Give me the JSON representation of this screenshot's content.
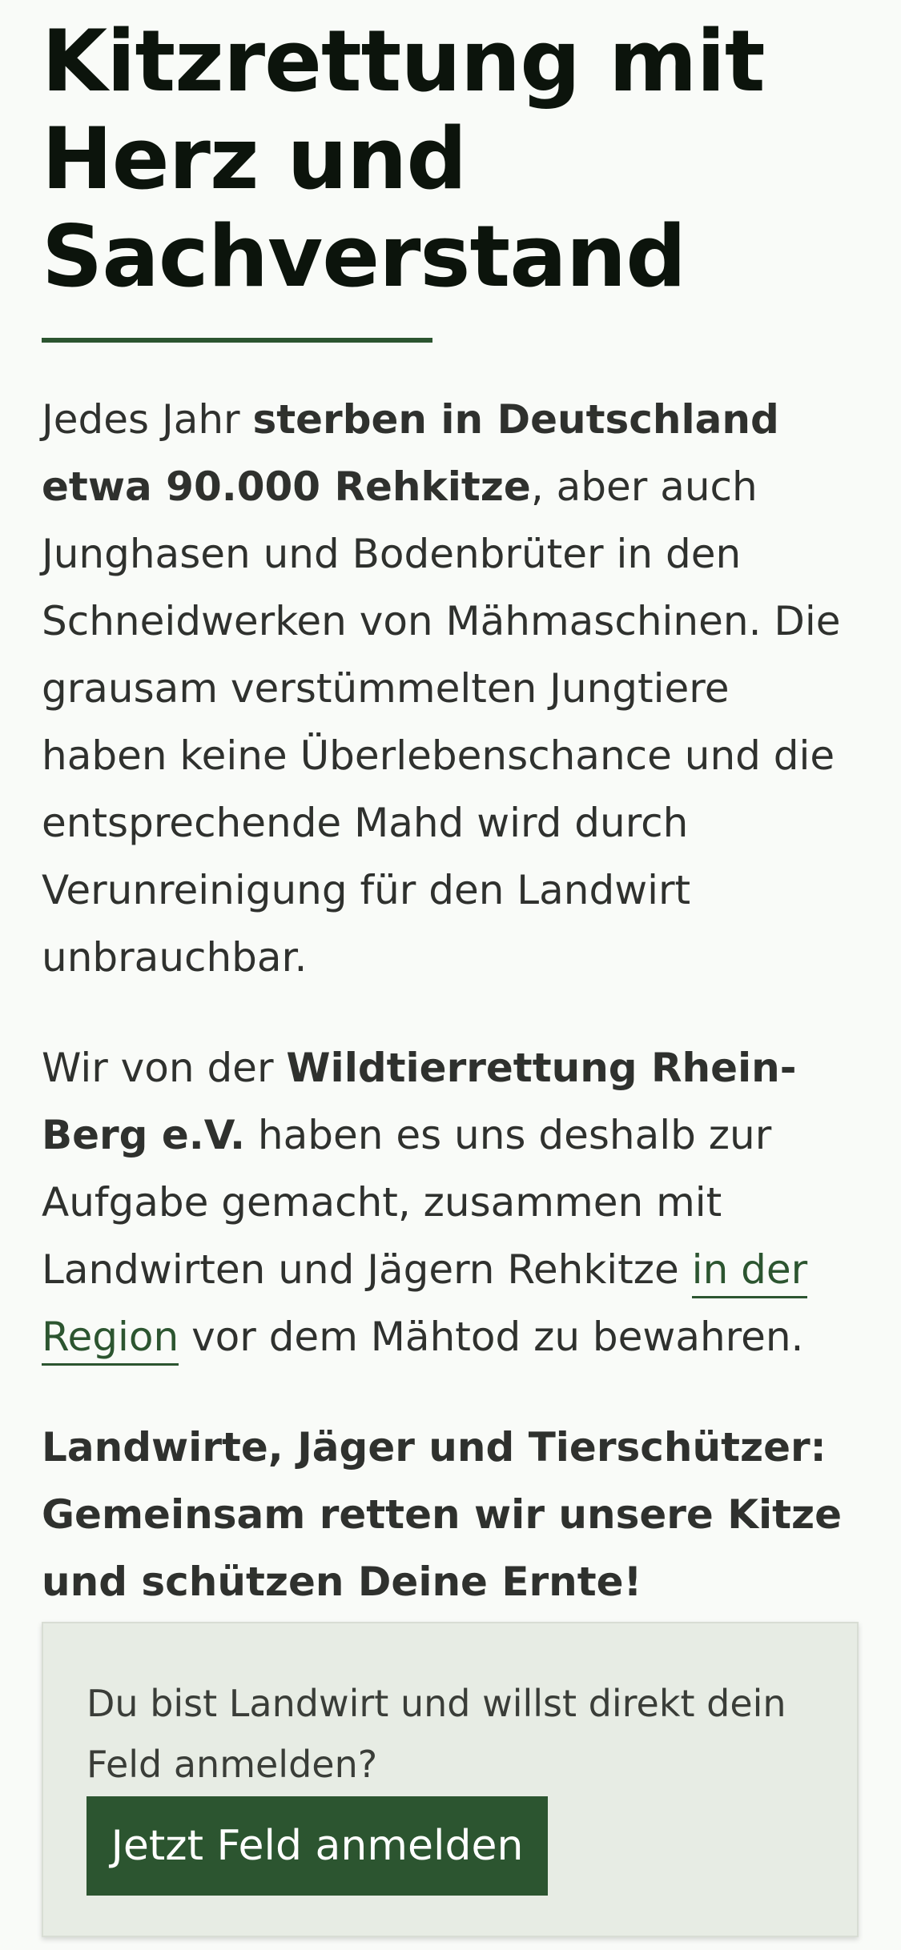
{
  "hero": {
    "title_line1": "Kitzrettung mit",
    "title_line2": "Herz und",
    "title_line3": "Sachverstand"
  },
  "intro": {
    "p1_start": "Jedes Jahr ",
    "p1_bold": "sterben in Deutschland etwa 90.000 Rehkitze",
    "p1_end": ", aber auch Junghasen und Bodenbrüter in den Schneidwerken von Mähmaschinen. Die grausam verstümmelten Jungtiere haben keine Überlebenschance und die entsprechende Mahd wird durch Verunreinigung für den Landwirt unbrauchbar.",
    "p2_start": "Wir von der ",
    "p2_bold": "Wildtierrettung Rhein-Berg e.V.",
    "p2_middle": " haben es uns deshalb zur Aufgabe gemacht, zusammen mit Landwirten und Jägern Rehkitze ",
    "p2_link": "in der Region",
    "p2_end": " vor dem Mähtod zu bewahren.",
    "p3": "Landwirte, Jäger und Tierschützer: Gemeinsam retten wir unsere Kitze und schützen Deine Ernte!"
  },
  "cta": {
    "text": "Du bist Landwirt und willst direkt dein Feld anmelden?",
    "button_label": "Jetzt Feld anmelden"
  },
  "colors": {
    "accent_green": "#2c5530",
    "background": "#f9fbf8",
    "cta_background": "#e7ece4"
  }
}
